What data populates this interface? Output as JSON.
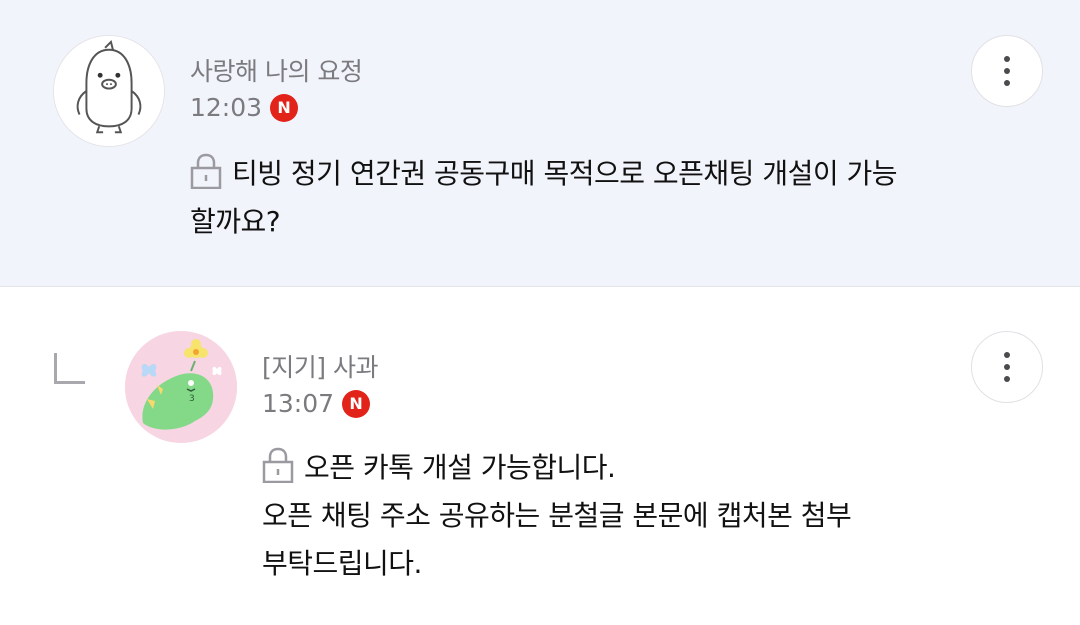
{
  "comments": [
    {
      "nickname": "사랑해 나의 요정",
      "time": "12:03",
      "badge": "N",
      "text_lines": [
        "티빙 정기 연간권 공동구매 목적으로 오픈채팅 개설이 가능",
        "할까요?"
      ],
      "secret": true
    },
    {
      "nickname": "[지기] 사과",
      "time": "13:07",
      "badge": "N",
      "text_lines": [
        "오픈 카톡 개설 가능합니다.",
        "오픈 채팅 주소 공유하는 분철글 본문에 캡처본 첨부",
        "부탁드립니다."
      ],
      "secret": true,
      "is_reply": true
    }
  ],
  "colors": {
    "parent_bg": "#f2f4fb",
    "badge_red": "#e2231a",
    "meta_gray": "#7a7a7f"
  },
  "icons": {
    "lock": "lock-icon",
    "more": "more-vertical-icon",
    "reply": "reply-indicator-icon"
  }
}
